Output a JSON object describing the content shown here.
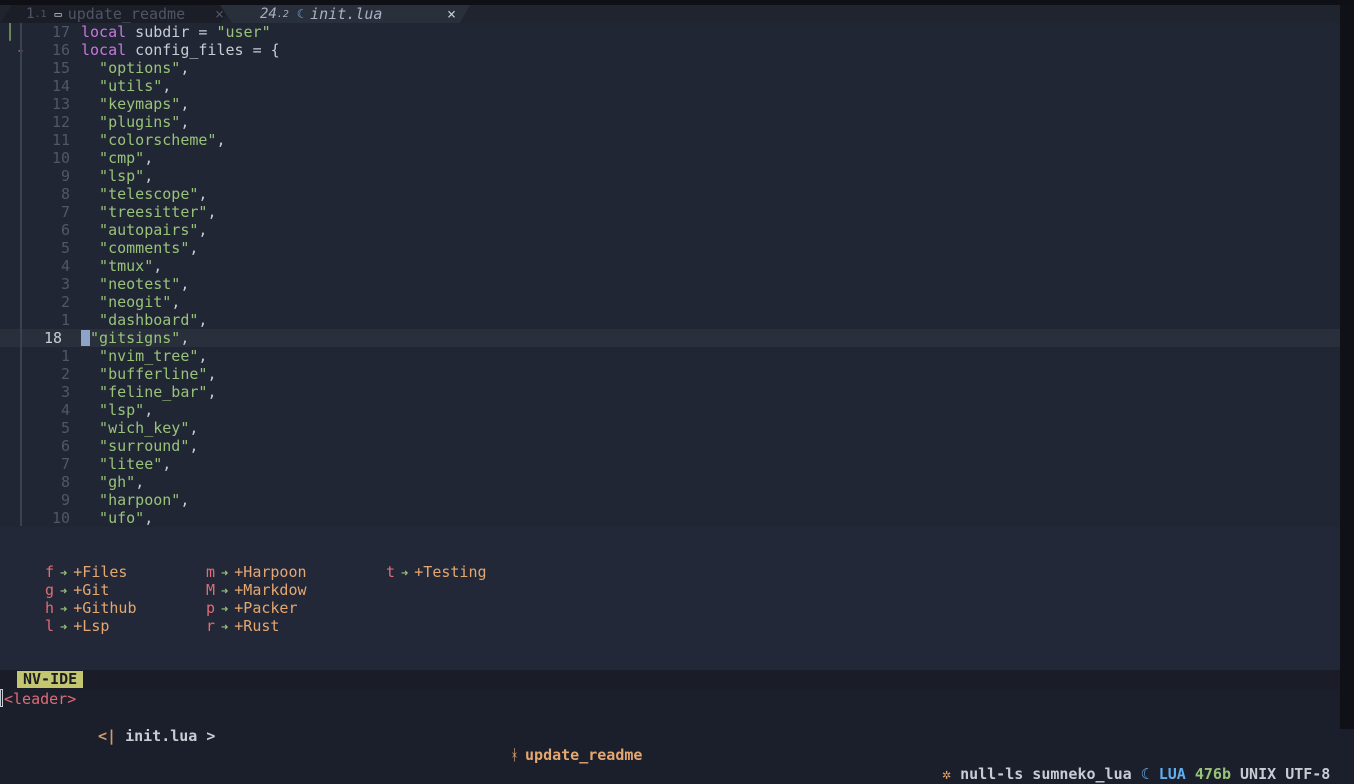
{
  "tabline": {
    "tabs": [
      {
        "number": "1",
        "sub": ".1",
        "icon": "file-icon",
        "label": "update_readme",
        "close": "×"
      },
      {
        "number": "24",
        "sub": ".2",
        "icon": "lua-icon",
        "label": "init.lua",
        "close": "×"
      }
    ]
  },
  "editor": {
    "lines": [
      {
        "num": "17",
        "sign": "│",
        "tokens": [
          [
            "kw",
            "local"
          ],
          [
            "op",
            " subdir = "
          ],
          [
            "str",
            "\"user\""
          ]
        ]
      },
      {
        "num": "16",
        "sign": "-",
        "tokens": [
          [
            "kw",
            "local"
          ],
          [
            "op",
            " config_files = {"
          ]
        ]
      },
      {
        "num": "15",
        "tokens": [
          [
            "str",
            "  \"options\""
          ],
          [
            "op",
            ","
          ]
        ]
      },
      {
        "num": "14",
        "tokens": [
          [
            "str",
            "  \"utils\""
          ],
          [
            "op",
            ","
          ]
        ]
      },
      {
        "num": "13",
        "tokens": [
          [
            "str",
            "  \"keymaps\""
          ],
          [
            "op",
            ","
          ]
        ]
      },
      {
        "num": "12",
        "tokens": [
          [
            "str",
            "  \"plugins\""
          ],
          [
            "op",
            ","
          ]
        ]
      },
      {
        "num": "11",
        "tokens": [
          [
            "str",
            "  \"colorscheme\""
          ],
          [
            "op",
            ","
          ]
        ]
      },
      {
        "num": "10",
        "tokens": [
          [
            "str",
            "  \"cmp\""
          ],
          [
            "op",
            ","
          ]
        ]
      },
      {
        "num": "9",
        "tokens": [
          [
            "str",
            "  \"lsp\""
          ],
          [
            "op",
            ","
          ]
        ]
      },
      {
        "num": "8",
        "tokens": [
          [
            "str",
            "  \"telescope\""
          ],
          [
            "op",
            ","
          ]
        ]
      },
      {
        "num": "7",
        "tokens": [
          [
            "str",
            "  \"treesitter\""
          ],
          [
            "op",
            ","
          ]
        ]
      },
      {
        "num": "6",
        "tokens": [
          [
            "str",
            "  \"autopairs\""
          ],
          [
            "op",
            ","
          ]
        ]
      },
      {
        "num": "5",
        "tokens": [
          [
            "str",
            "  \"comments\""
          ],
          [
            "op",
            ","
          ]
        ]
      },
      {
        "num": "4",
        "tokens": [
          [
            "str",
            "  \"tmux\""
          ],
          [
            "op",
            ","
          ]
        ]
      },
      {
        "num": "3",
        "tokens": [
          [
            "str",
            "  \"neotest\""
          ],
          [
            "op",
            ","
          ]
        ]
      },
      {
        "num": "2",
        "tokens": [
          [
            "str",
            "  \"neogit\""
          ],
          [
            "op",
            ","
          ]
        ]
      },
      {
        "num": "1",
        "tokens": [
          [
            "str",
            "  \"dashboard\""
          ],
          [
            "op",
            ","
          ]
        ]
      },
      {
        "num": "18",
        "current": true,
        "tokens": [
          [
            "str",
            "\"gitsigns\""
          ],
          [
            "op",
            ","
          ]
        ]
      },
      {
        "num": "1",
        "tokens": [
          [
            "str",
            "  \"nvim_tree\""
          ],
          [
            "op",
            ","
          ]
        ]
      },
      {
        "num": "2",
        "tokens": [
          [
            "str",
            "  \"bufferline\""
          ],
          [
            "op",
            ","
          ]
        ]
      },
      {
        "num": "3",
        "tokens": [
          [
            "str",
            "  \"feline_bar\""
          ],
          [
            "op",
            ","
          ]
        ]
      },
      {
        "num": "4",
        "tokens": [
          [
            "str",
            "  \"lsp\""
          ],
          [
            "op",
            ","
          ]
        ]
      },
      {
        "num": "5",
        "tokens": [
          [
            "str",
            "  \"wich_key\""
          ],
          [
            "op",
            ","
          ]
        ]
      },
      {
        "num": "6",
        "tokens": [
          [
            "str",
            "  \"surround\""
          ],
          [
            "op",
            ","
          ]
        ]
      },
      {
        "num": "7",
        "tokens": [
          [
            "str",
            "  \"litee\""
          ],
          [
            "op",
            ","
          ]
        ]
      },
      {
        "num": "8",
        "tokens": [
          [
            "str",
            "  \"gh\""
          ],
          [
            "op",
            ","
          ]
        ]
      },
      {
        "num": "9",
        "tokens": [
          [
            "str",
            "  \"harpoon\""
          ],
          [
            "op",
            ","
          ]
        ]
      },
      {
        "num": "10",
        "tokens": [
          [
            "str",
            "  \"ufo\""
          ],
          [
            "op",
            ","
          ]
        ]
      }
    ]
  },
  "whichkey": {
    "arrow": "➜",
    "columns": [
      [
        {
          "key": "f",
          "label": "+Files"
        },
        {
          "key": "g",
          "label": "+Git"
        },
        {
          "key": "h",
          "label": "+Github"
        },
        {
          "key": "l",
          "label": "+Lsp"
        }
      ],
      [
        {
          "key": "m",
          "label": "+Harpoon"
        },
        {
          "key": "M",
          "label": "+Markdow"
        },
        {
          "key": "p",
          "label": "+Packer"
        },
        {
          "key": "r",
          "label": "+Rust"
        }
      ],
      [
        {
          "key": "t",
          "label": "+Testing"
        }
      ]
    ]
  },
  "statusline": {
    "left_edge": "<",
    "mode": "NV-IDE",
    "file_prefix": "<|",
    "file": "init.lua",
    "file_suffix": ">",
    "branch_icon": "branch-icon",
    "branch": "update_readme",
    "lsp_icon": "gear-icon",
    "lsp_clients": "null-ls sumneko_lua",
    "lang_icon": "lua-icon",
    "lang": "LUA",
    "size": "476b",
    "format": "UNIX",
    "encoding": "UTF-8"
  },
  "cmdline": {
    "text": "<leader>"
  },
  "colors": {
    "background": "#212634",
    "keyword": "#c678dd",
    "string": "#98c379",
    "mode_bg": "#c3c66e",
    "accent": "#e5a770"
  }
}
